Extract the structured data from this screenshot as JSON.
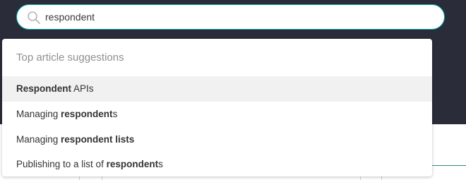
{
  "search": {
    "value": "respondent"
  },
  "suggestions": {
    "heading": "Top article suggestions",
    "items": [
      {
        "pre": "",
        "bold": "Respondent",
        "post": " APIs",
        "highlighted": true
      },
      {
        "pre": "Managing ",
        "bold": "respondent",
        "post": "s",
        "highlighted": false
      },
      {
        "pre": "Managing ",
        "bold": "respondent lists",
        "post": "",
        "highlighted": false
      },
      {
        "pre": "Publishing to a list of ",
        "bold": "respondent",
        "post": "s",
        "highlighted": false
      }
    ]
  },
  "colors": {
    "header_background": "#2a2c3a",
    "accent": "#00a7a0",
    "highlight_row": "#f1f1f1"
  },
  "icons": {
    "search": "search-icon"
  }
}
